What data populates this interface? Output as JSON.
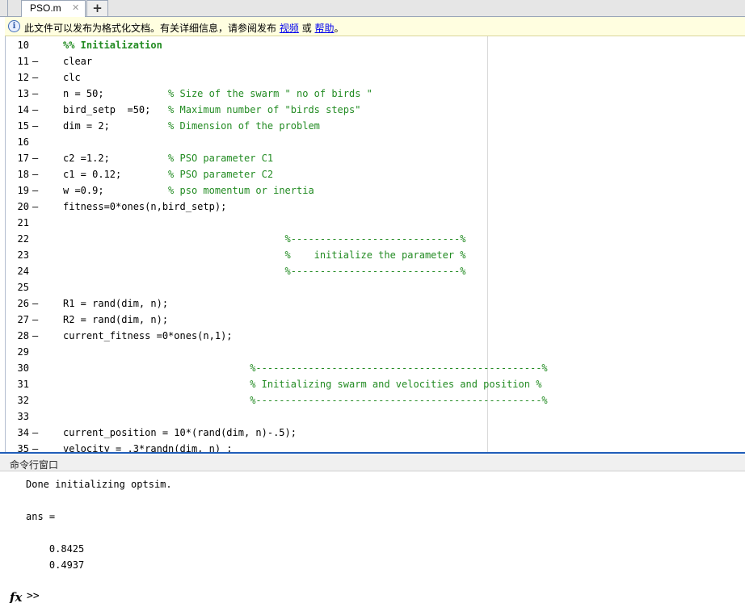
{
  "tab": {
    "filename": "PSO.m",
    "close_glyph": "✕",
    "new_tab_glyph": "+"
  },
  "info": {
    "icon": "i",
    "text": "此文件可以发布为格式化文档。有关详细信息，请参阅发布",
    "link_video": "视频",
    "connector": "或",
    "link_help": "帮助",
    "end": "。"
  },
  "editor": {
    "lines": [
      {
        "n": "10",
        "dash": "",
        "code": "",
        "comment": "",
        "cell": "%% Initialization"
      },
      {
        "n": "11",
        "dash": "–",
        "code": "clear",
        "comment": "",
        "cell": ""
      },
      {
        "n": "12",
        "dash": "–",
        "code": "clc",
        "comment": "",
        "cell": ""
      },
      {
        "n": "13",
        "dash": "–",
        "code": "n = 50;           ",
        "comment": "% Size of the swarm \" no of birds \"",
        "cell": ""
      },
      {
        "n": "14",
        "dash": "–",
        "code": "bird_setp  =50;   ",
        "comment": "% Maximum number of \"birds steps\"",
        "cell": ""
      },
      {
        "n": "15",
        "dash": "–",
        "code": "dim = 2;          ",
        "comment": "% Dimension of the problem",
        "cell": ""
      },
      {
        "n": "16",
        "dash": "",
        "code": "",
        "comment": "",
        "cell": ""
      },
      {
        "n": "17",
        "dash": "–",
        "code": "c2 =1.2;          ",
        "comment": "% PSO parameter C1",
        "cell": ""
      },
      {
        "n": "18",
        "dash": "–",
        "code": "c1 = 0.12;        ",
        "comment": "% PSO parameter C2",
        "cell": ""
      },
      {
        "n": "19",
        "dash": "–",
        "code": "w =0.9;           ",
        "comment": "% pso momentum or inertia",
        "cell": ""
      },
      {
        "n": "20",
        "dash": "–",
        "code": "fitness=0*ones(n,bird_setp);",
        "comment": "",
        "cell": ""
      },
      {
        "n": "21",
        "dash": "",
        "code": "",
        "comment": "",
        "cell": ""
      },
      {
        "n": "22",
        "dash": "",
        "code": "                                      ",
        "comment": "%-----------------------------%",
        "cell": ""
      },
      {
        "n": "23",
        "dash": "",
        "code": "                                      ",
        "comment": "%    initialize the parameter %",
        "cell": ""
      },
      {
        "n": "24",
        "dash": "",
        "code": "                                      ",
        "comment": "%-----------------------------%",
        "cell": ""
      },
      {
        "n": "25",
        "dash": "",
        "code": "",
        "comment": "",
        "cell": ""
      },
      {
        "n": "26",
        "dash": "–",
        "code": "R1 = rand(dim, n);",
        "comment": "",
        "cell": ""
      },
      {
        "n": "27",
        "dash": "–",
        "code": "R2 = rand(dim, n);",
        "comment": "",
        "cell": ""
      },
      {
        "n": "28",
        "dash": "–",
        "code": "current_fitness =0*ones(n,1);",
        "comment": "",
        "cell": ""
      },
      {
        "n": "29",
        "dash": "",
        "code": "",
        "comment": "",
        "cell": ""
      },
      {
        "n": "30",
        "dash": "",
        "code": "                                ",
        "comment": "%-------------------------------------------------%",
        "cell": ""
      },
      {
        "n": "31",
        "dash": "",
        "code": "                                ",
        "comment": "% Initializing swarm and velocities and position %",
        "cell": ""
      },
      {
        "n": "32",
        "dash": "",
        "code": "                                ",
        "comment": "%-------------------------------------------------%",
        "cell": ""
      },
      {
        "n": "33",
        "dash": "",
        "code": "",
        "comment": "",
        "cell": ""
      },
      {
        "n": "34",
        "dash": "–",
        "code": "current_position = 10*(rand(dim, n)-.5);",
        "comment": "",
        "cell": ""
      },
      {
        "n": "35",
        "dash": "–",
        "code": "velocity = .3*randn(dim, n) ;",
        "comment": "",
        "cell": ""
      }
    ]
  },
  "command_window": {
    "title": "命令行窗口",
    "lines": [
      "Done initializing optsim.",
      "",
      "ans =",
      "",
      "    0.8425",
      "    0.4937"
    ],
    "fx_label": "fx",
    "prompt": ">>"
  }
}
